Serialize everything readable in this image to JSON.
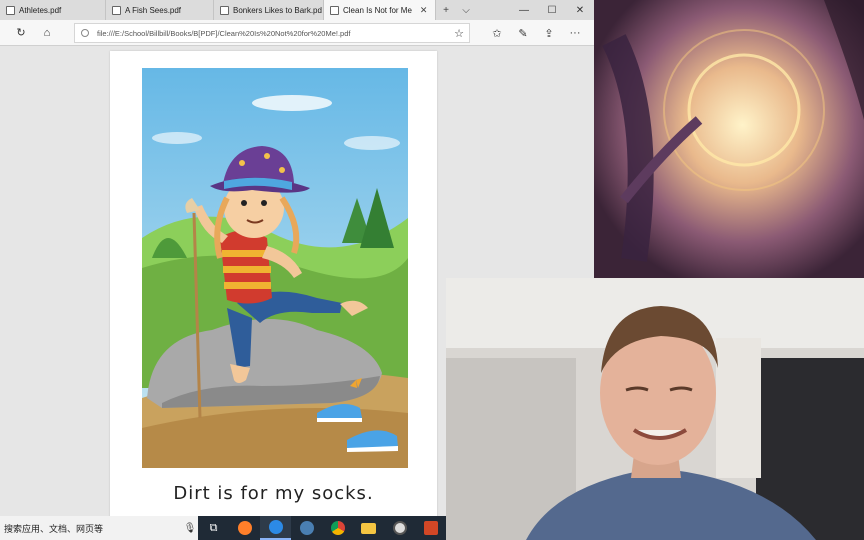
{
  "browser": {
    "tabs": [
      {
        "label": "Athletes.pdf",
        "active": false
      },
      {
        "label": "A Fish Sees.pdf",
        "active": false
      },
      {
        "label": "Bonkers Likes to Bark.pd",
        "active": false
      },
      {
        "label": "Clean Is Not for Me",
        "active": true
      }
    ],
    "new_tab_symbol": "+",
    "tab_list_symbol": "⌵",
    "window_controls": {
      "minimize": "—",
      "maximize": "☐",
      "close": "✕"
    },
    "address_url": "file:///E:/School/Billbill/Books/B[PDF]/Clean%20Is%20Not%20for%20Me!.pdf",
    "toolbar_icons": [
      "refresh-icon",
      "home-icon",
      "favorites-star-icon",
      "reading-list-icon",
      "pen-icon",
      "share-icon",
      "more-icon"
    ],
    "icon_glyphs": {
      "refresh": "↻",
      "home": "⌂",
      "star": "☆",
      "favorites": "✩",
      "pen": "✎",
      "share": "⇪",
      "more": "···"
    }
  },
  "document": {
    "caption": "Dirt is for my socks."
  },
  "taskbar": {
    "search_placeholder": "搜索应用、文档、网页等",
    "mic_glyph": "🎙",
    "apps": [
      "task-view-icon",
      "firefox-icon",
      "edge-icon",
      "steam-icon",
      "chrome-icon",
      "file-explorer-icon",
      "browser-globe-icon",
      "powerpoint-icon"
    ],
    "task_view_glyph": "⧉"
  },
  "colors": {
    "tabbar_bg": "#dcdcdc",
    "active_tab_bg": "#f7f7f7",
    "taskbar_bg": "#1f2a36",
    "pdf_bg": "#e6e6e6",
    "sky": "#7ec3e8",
    "grass": "#7cba4c",
    "dirt": "#c9a25e"
  }
}
